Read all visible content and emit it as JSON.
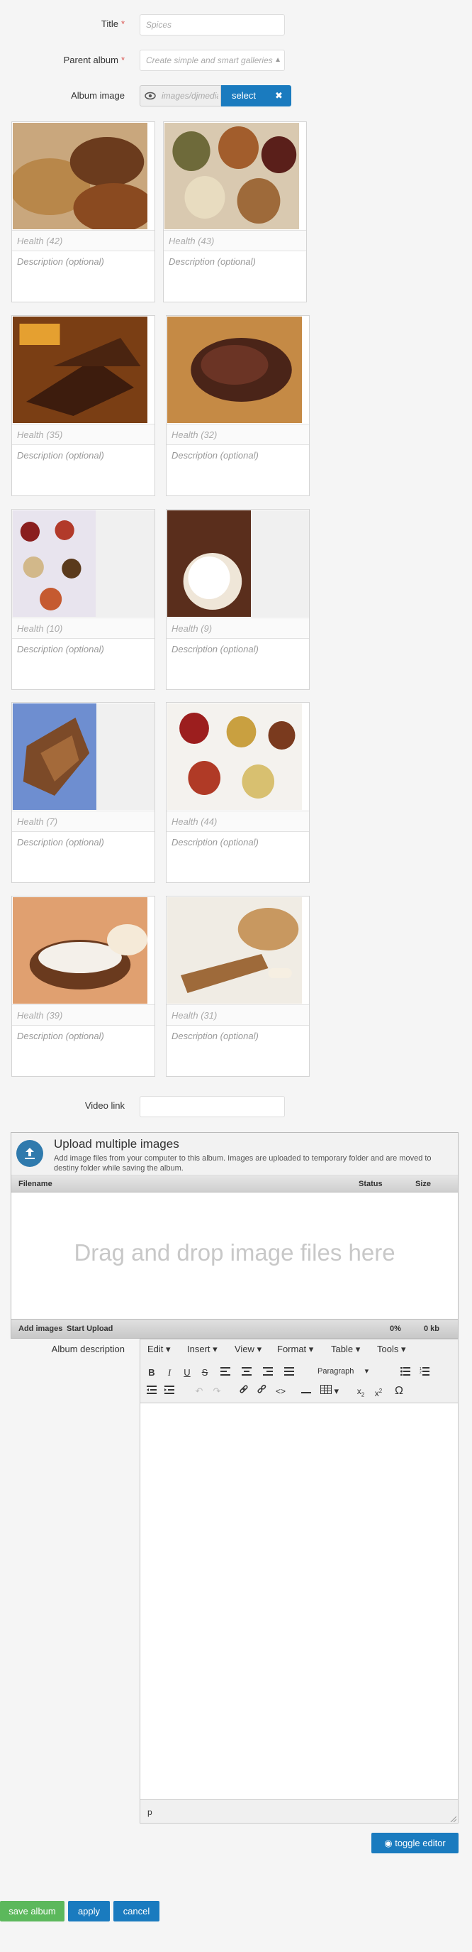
{
  "form": {
    "title_label": "Title",
    "title_placeholder": "Spices",
    "parent_label": "Parent album",
    "parent_placeholder": "Create simple and smart galleries",
    "image_label": "Album image",
    "image_path": "images/djmediatools/...",
    "select_label": "select",
    "clear_label": "✖",
    "video_label": "Video link",
    "desc_label": "Album description"
  },
  "images": [
    {
      "caption": "Health (42)",
      "desc": "Description (optional)"
    },
    {
      "caption": "Health (43)",
      "desc": "Description (optional)"
    },
    {
      "caption": "Health (35)",
      "desc": "Description (optional)"
    },
    {
      "caption": "Health (32)",
      "desc": "Description (optional)"
    },
    {
      "caption": "Health (10)",
      "desc": "Description (optional)"
    },
    {
      "caption": "Health (9)",
      "desc": "Description (optional)"
    },
    {
      "caption": "Health (7)",
      "desc": "Description (optional)"
    },
    {
      "caption": "Health (44)",
      "desc": "Description (optional)"
    },
    {
      "caption": "Health (39)",
      "desc": "Description (optional)"
    },
    {
      "caption": "Health (31)",
      "desc": "Description (optional)"
    }
  ],
  "upload": {
    "title": "Upload multiple images",
    "subtitle": "Add image files from your computer to this album. Images are uploaded to temporary folder and are moved to destiny folder while saving the album.",
    "col_filename": "Filename",
    "col_status": "Status",
    "col_size": "Size",
    "dropzone": "Drag and drop image files here",
    "add_label": "Add images",
    "start_label": "Start Upload",
    "percent": "0%",
    "size": "0 kb"
  },
  "editor": {
    "menus": [
      "Edit",
      "Insert",
      "View",
      "Format",
      "Table",
      "Tools"
    ],
    "paragraph": "Paragraph",
    "path": "p",
    "toggle_label": "toggle editor"
  },
  "actions": {
    "save": "save album",
    "apply": "apply",
    "cancel": "cancel"
  },
  "colors": {
    "primary": "#1a7bbf",
    "success": "#5cb85c",
    "required": "#d9534f"
  }
}
